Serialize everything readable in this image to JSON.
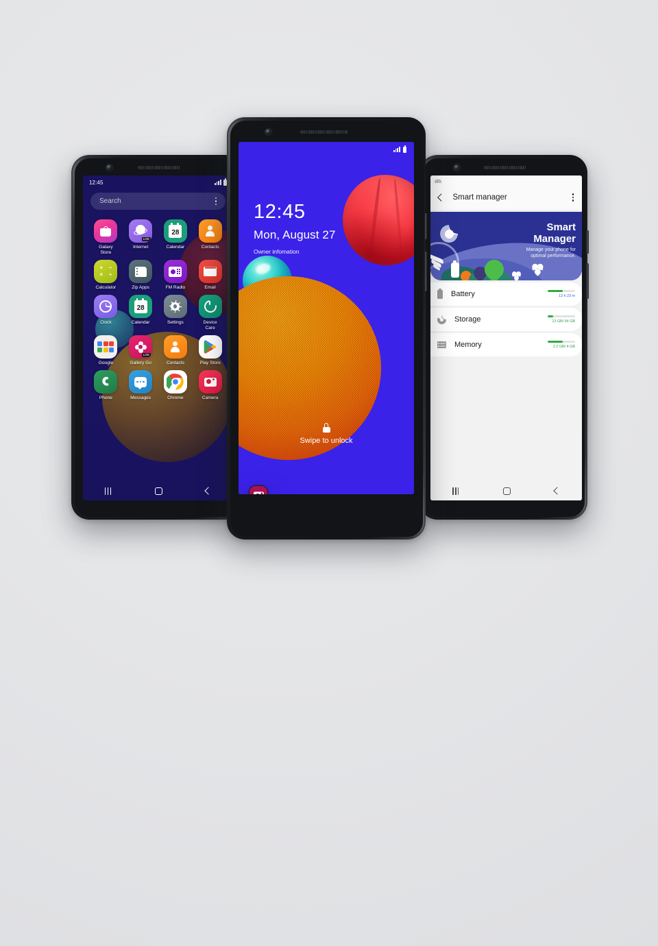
{
  "scene": {
    "background_color": "#e4e5e7",
    "device_count": 3
  },
  "left_phone": {
    "name": "home-screen-phone",
    "status_bar": {
      "time": "12:45",
      "signal_icon": "signal-bars-icon",
      "battery_icon": "battery-icon"
    },
    "search": {
      "placeholder": "Search",
      "menu_icon": "kebab-menu-icon"
    },
    "apps": [
      {
        "label": "Galaxy\nStore",
        "icon": "galaxy-store-icon",
        "key": "galaxystore"
      },
      {
        "label": "Internet",
        "icon": "internet-icon",
        "key": "internet",
        "badge": "LITE"
      },
      {
        "label": "Calendar",
        "icon": "calendar-icon",
        "key": "calendar",
        "day": "28"
      },
      {
        "label": "Contacts",
        "icon": "contacts-icon",
        "key": "contacts"
      },
      {
        "label": "Calculator",
        "icon": "calculator-icon",
        "key": "calculator"
      },
      {
        "label": "Zip Apps",
        "icon": "zip-apps-icon",
        "key": "zipapps"
      },
      {
        "label": "FM Radio",
        "icon": "fm-radio-icon",
        "key": "fmradio"
      },
      {
        "label": "Email",
        "icon": "email-icon",
        "key": "email"
      },
      {
        "label": "Clock",
        "icon": "clock-icon",
        "key": "clock"
      },
      {
        "label": "Calendar",
        "icon": "calendar-icon",
        "key": "calendar2",
        "day": "28"
      },
      {
        "label": "Settings",
        "icon": "settings-gear-icon",
        "key": "settings"
      },
      {
        "label": "Device\nCare",
        "icon": "device-care-icon",
        "key": "devicecare"
      },
      {
        "label": "Google",
        "icon": "google-folder-icon",
        "key": "google"
      },
      {
        "label": "Gallery Go",
        "icon": "gallery-go-icon",
        "key": "gallerygo",
        "badge": "LITE"
      },
      {
        "label": "Contacts",
        "icon": "contacts-icon",
        "key": "contacts2"
      },
      {
        "label": "Play Store",
        "icon": "play-store-icon",
        "key": "playstore"
      },
      {
        "label": "Phone",
        "icon": "phone-icon",
        "key": "phone"
      },
      {
        "label": "Messages",
        "icon": "messages-icon",
        "key": "messages"
      },
      {
        "label": "Chrome",
        "icon": "chrome-icon",
        "key": "chrome"
      },
      {
        "label": "Camera",
        "icon": "camera-icon",
        "key": "camera"
      }
    ],
    "nav": {
      "recents": "recents-icon",
      "home": "home-icon",
      "back": "back-icon"
    }
  },
  "center_phone": {
    "name": "lock-screen-phone",
    "status_bar": {
      "signal_icon": "signal-bars-icon",
      "battery_icon": "battery-icon"
    },
    "lock": {
      "time": "12:45",
      "date": "Mon, August 27",
      "owner_info": "Owner infomation",
      "unlock_text": "Swipe to unlock",
      "lock_icon": "lock-icon",
      "shortcut_left": "phone-shortcut-icon",
      "shortcut_right": "camera-shortcut-icon"
    },
    "wallpaper": {
      "background_color": "#3a22e8",
      "spheres": [
        "teal-gradient-sphere",
        "orange-knit-sphere",
        "red-textured-sphere"
      ]
    }
  },
  "right_phone": {
    "name": "smart-manager-phone",
    "status_bar": {
      "wifi_icon": "wifi-icon"
    },
    "app_bar": {
      "back_icon": "back-chevron-icon",
      "title": "Smart manager",
      "menu_icon": "kebab-menu-icon"
    },
    "banner": {
      "title_line1": "Smart",
      "title_line2": "Manager",
      "subtitle_line1": "Manage your phone for",
      "subtitle_line2": "optimal performance.",
      "background_color": "#2b3192",
      "accent_color": "#6972c4"
    },
    "items": [
      {
        "label": "Battery",
        "icon": "battery-icon",
        "key": "battery",
        "value": "13 h 23 m",
        "value_color": "#2d6ed4",
        "progress_pct": 55
      },
      {
        "label": "Storage",
        "icon": "storage-pie-icon",
        "key": "storage",
        "value": "13 GB/ 64 GB",
        "value_color": "#3a9e4d",
        "progress_pct": 20
      },
      {
        "label": "Memory",
        "icon": "memory-chip-icon",
        "key": "memory",
        "value": "2.2 GB/ 4 GB",
        "value_color": "#3a9e4d",
        "progress_pct": 55
      }
    ],
    "nav": {
      "recents": "recents-icon",
      "home": "home-icon",
      "back": "back-icon"
    }
  }
}
